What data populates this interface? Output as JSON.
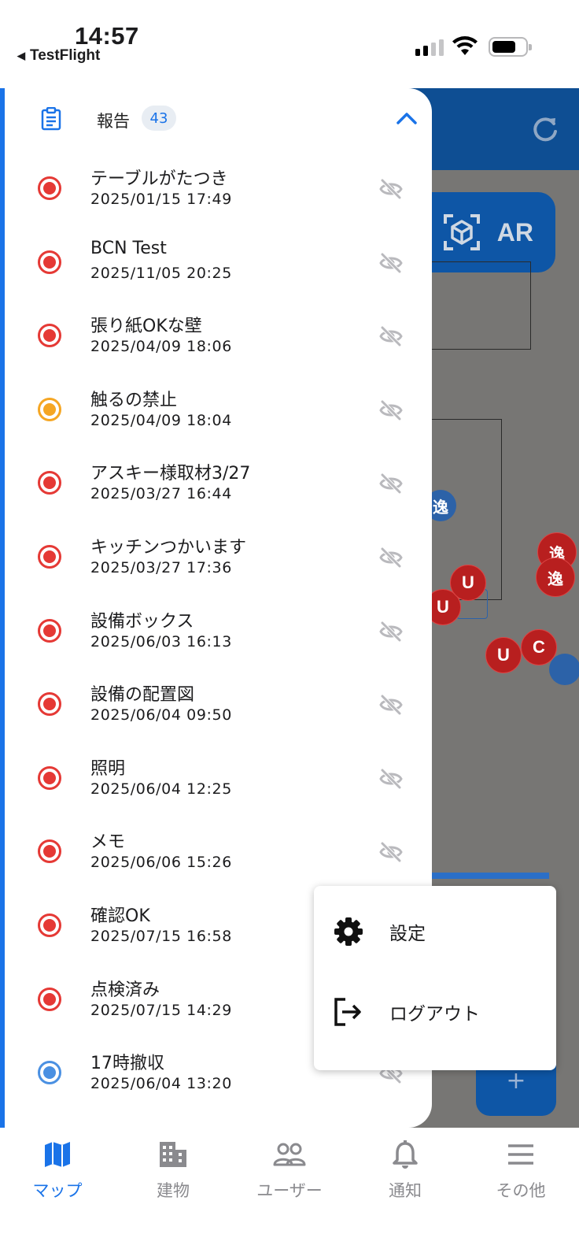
{
  "status_bar": {
    "time": "14:57",
    "back_app": "TestFlight"
  },
  "map": {
    "ar_label": "AR",
    "pins": [
      "逸",
      "逸",
      "逸",
      "U",
      "U",
      "U",
      "C"
    ]
  },
  "drawer": {
    "title": "報告",
    "count": "43",
    "items": [
      {
        "title": "テーブルがたつき",
        "date": "2025/01/15 17:49",
        "status_color": "#e53935"
      },
      {
        "title": "BCN Test",
        "date": "2025/11/05 20:25",
        "status_color": "#e53935"
      },
      {
        "title": "張り紙OKな壁",
        "date": "2025/04/09 18:06",
        "status_color": "#e53935"
      },
      {
        "title": "触るの禁止",
        "date": "2025/04/09 18:04",
        "status_color": "#f5a623"
      },
      {
        "title": "アスキー様取材3/27",
        "date": "2025/03/27 16:44",
        "status_color": "#e53935"
      },
      {
        "title": "キッチンつかいます",
        "date": "2025/03/27 17:36",
        "status_color": "#e53935"
      },
      {
        "title": "設備ボックス",
        "date": "2025/06/03 16:13",
        "status_color": "#e53935"
      },
      {
        "title": "設備の配置図",
        "date": "2025/06/04 09:50",
        "status_color": "#e53935"
      },
      {
        "title": "照明",
        "date": "2025/06/04 12:25",
        "status_color": "#e53935"
      },
      {
        "title": "メモ",
        "date": "2025/06/06 15:26",
        "status_color": "#e53935"
      },
      {
        "title": "確認OK",
        "date": "2025/07/15 16:58",
        "status_color": "#e53935"
      },
      {
        "title": "点検済み",
        "date": "2025/07/15 14:29",
        "status_color": "#e53935"
      },
      {
        "title": "17時撤収",
        "date": "2025/06/04 13:20",
        "status_color": "#4a90e2"
      }
    ]
  },
  "menu": {
    "settings": "設定",
    "logout": "ログアウト"
  },
  "nav": {
    "map": "マップ",
    "buildings": "建物",
    "users": "ユーザー",
    "notifications": "通知",
    "other": "その他"
  },
  "colors": {
    "accent": "#1a73e8",
    "map_header": "#0e4e93",
    "alert_red": "#e53935"
  }
}
